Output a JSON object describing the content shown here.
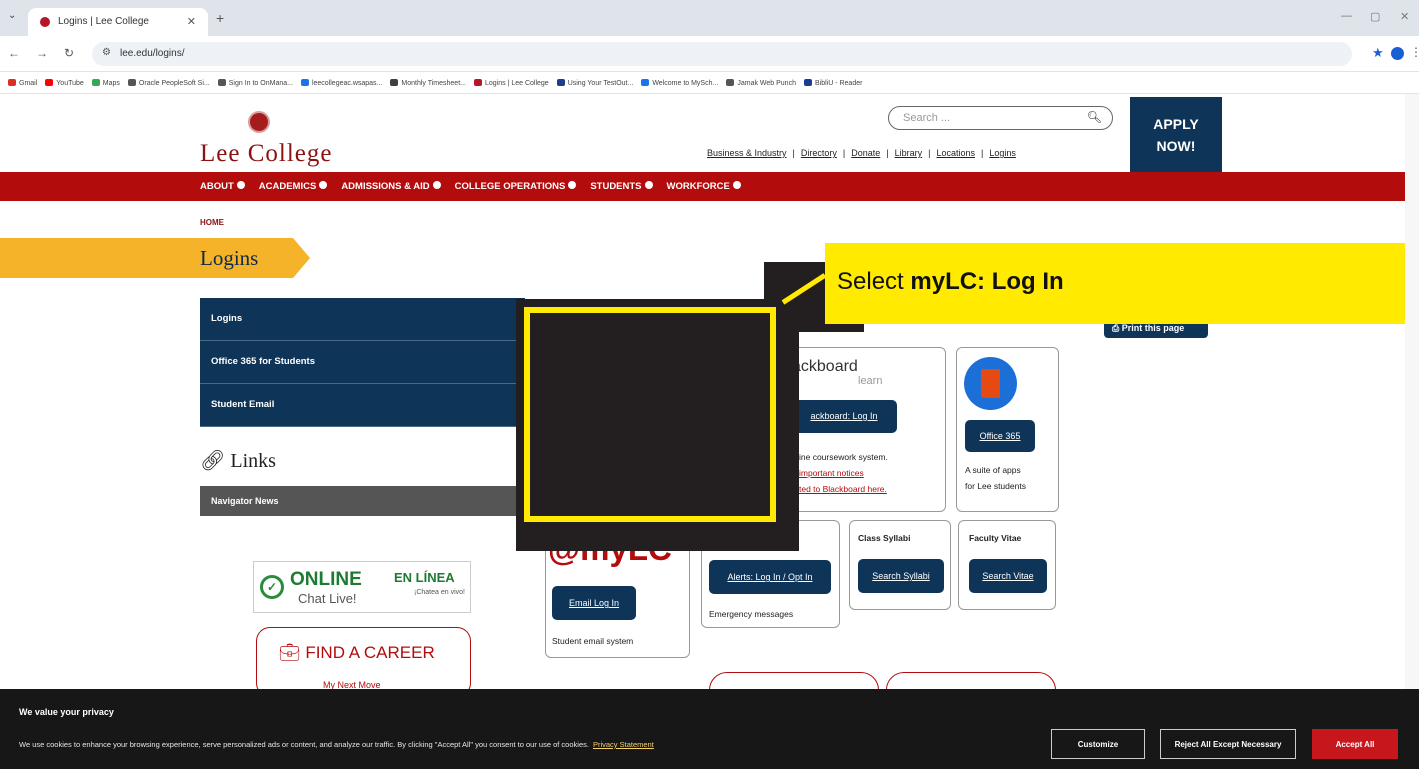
{
  "browser": {
    "tab_title": "Logins | Lee College",
    "url": "lee.edu/logins/",
    "bookmarks": [
      {
        "label": "Gmail",
        "color": "#d93025"
      },
      {
        "label": "YouTube",
        "color": "#ff0000"
      },
      {
        "label": "Maps",
        "color": "#34a853"
      },
      {
        "label": "Oracle PeopleSoft Si...",
        "color": "#555555"
      },
      {
        "label": "Sign In to OnMana...",
        "color": "#555555"
      },
      {
        "label": "leecollegeac.wsapas...",
        "color": "#1a73e8"
      },
      {
        "label": "Monthly Timesheet...",
        "color": "#3c4043"
      },
      {
        "label": "Logins | Lee College",
        "color": "#b5172a"
      },
      {
        "label": "Using Your TestOut...",
        "color": "#1a3d8f"
      },
      {
        "label": "Welcome to MySch...",
        "color": "#1a73e8"
      },
      {
        "label": "Jamak Web Punch",
        "color": "#555555"
      },
      {
        "label": "BibliU - Reader",
        "color": "#1a3d8f"
      }
    ]
  },
  "header": {
    "logo_text": "Lee College",
    "search_placeholder": "Search ...",
    "util_links": [
      "Business & Industry",
      "Directory",
      "Donate",
      "Library",
      "Locations",
      "Logins"
    ],
    "apply_line1": "APPLY",
    "apply_line2": "NOW!"
  },
  "nav": [
    "ABOUT",
    "ACADEMICS",
    "ADMISSIONS & AID",
    "COLLEGE OPERATIONS",
    "STUDENTS",
    "WORKFORCE"
  ],
  "breadcrumb": "HOME",
  "page_title": "Logins",
  "sidebar": {
    "items": [
      "Logins",
      "Office 365 for Students",
      "Student Email"
    ],
    "links_heading": "Links",
    "navigator_news": "Navigator News",
    "online_title": "ONLINE",
    "online_sub": "Chat Live!",
    "en_linea": "EN LÍNEA",
    "chatea": "¡Chatea en vivo!",
    "career_title": "FIND A CAREER",
    "career_sub": "My Next Move"
  },
  "cards": {
    "print_label": "Print this page",
    "blackboard_logo": "ackboard",
    "blackboard_sub": "learn",
    "blackboard_btn": "ackboard: Log In",
    "blackboard_desc1": "ine coursework system.",
    "blackboard_desc2": "important notices",
    "blackboard_desc3": "ted to Blackboard here.",
    "office_btn": "Office 365",
    "office_desc1": "A suite of apps",
    "office_desc2": "for Lee students",
    "mylc_big": "@myLC",
    "email_btn": "Email Log In",
    "email_desc": "Student email system",
    "alerts_btn": "Alerts: Log In / Opt In",
    "alerts_desc": "Emergency messages",
    "syllabi_head": "Class Syllabi",
    "syllabi_btn": "Search Syllabi",
    "vitae_head": "Faculty Vitae",
    "vitae_btn": "Search Vitae"
  },
  "callout": {
    "prefix": "Select ",
    "bold": "myLC: Log In",
    "highlight_color": "#ffea00"
  },
  "cookie": {
    "heading": "We value your privacy",
    "body": "We use cookies to enhance your browsing experience, serve personalized ads or content, and analyze our traffic. By clicking \"Accept All\" you consent to our use of cookies.",
    "privacy_link": "Privacy Statement",
    "customize": "Customize",
    "reject": "Reject All Except Necessary",
    "accept": "Accept All"
  },
  "colors": {
    "brand_red": "#b20c0c",
    "navy": "#0e3458",
    "banner_gold": "#f5b32a"
  }
}
